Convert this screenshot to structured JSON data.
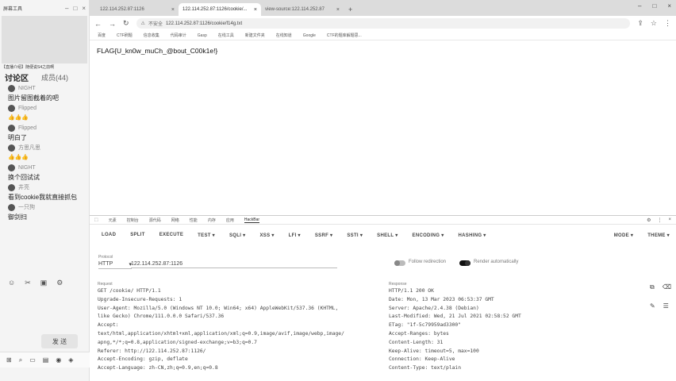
{
  "chat": {
    "window_title": "屏幕工具",
    "notice": "【直播介绍】随便说S4之前啊",
    "tab_discuss": "讨论区",
    "tab_members": "成员(44)",
    "messages": [
      {
        "user": "NIGHT",
        "text": "图片留图截着的吧",
        "emoji": ""
      },
      {
        "user": "Flipped",
        "text": "",
        "emoji": "👍👍👍"
      },
      {
        "user": "Flipped",
        "text": "明白了",
        "emoji": ""
      },
      {
        "user": "方思凡思",
        "text": "",
        "emoji": "👍👍👍"
      },
      {
        "user": "NIGHT",
        "text": "换个回试试",
        "emoji": ""
      },
      {
        "user": "井亮",
        "text": "看到cookie我就直接抓包",
        "emoji": ""
      },
      {
        "user": "一只狗",
        "text": "御剑扫",
        "emoji": ""
      }
    ],
    "send_label": "发 送"
  },
  "browser": {
    "tabs": [
      {
        "title": "122.114.252.87:1126",
        "active": false
      },
      {
        "title": "122.114.252.87:1126/cookie/...",
        "active": true
      },
      {
        "title": "view-source:122.114.252.87",
        "active": false
      }
    ],
    "address": {
      "security": "不安全",
      "url": "122.114.252.87:1126/cookie/f14g.txt"
    },
    "bookmarks": [
      "百度",
      "CTF刷题",
      "信息收集",
      "代码审计",
      "Gasp",
      "在线工具",
      "新建文件夹",
      "在线知道",
      "Google",
      "CTF的题库解题思..."
    ],
    "page_text": "FLAG{U_kn0w_muCh_@bout_C00k1e!}"
  },
  "devtools": {
    "tabs": [
      "元素",
      "控制台",
      "源代码",
      "网络",
      "性能",
      "内存",
      "应用",
      "HackBar"
    ],
    "active_tab": "HackBar",
    "hackbar_menu": [
      "LOAD",
      "SPLIT",
      "EXECUTE",
      "TEST ▾",
      "SQLI ▾",
      "XSS ▾",
      "LFI ▾",
      "SSRF ▾",
      "SSTI ▾",
      "SHELL ▾",
      "ENCODING ▾",
      "HASHING ▾"
    ],
    "hackbar_menu_right": [
      "MODE ▾",
      "THEME ▾"
    ],
    "method_label": "Protocol",
    "method": "HTTP",
    "url_value": "122.114.252.87:1126",
    "follow_redirection": "Follow redirection",
    "render_auto": "Render automatically",
    "request_label": "Request",
    "request_lines": [
      "GET /cookie/ HTTP/1.1",
      "Upgrade-Insecure-Requests: 1",
      "User-Agent: Mozilla/5.0 (Windows NT 10.0; Win64; x64) AppleWebKit/537.36 (KHTML,",
      "like Gecko) Chrome/111.0.0.0 Safari/537.36",
      "Accept:",
      "text/html,application/xhtml+xml,application/xml;q=0.9,image/avif,image/webp,image/",
      "apng,*/*;q=0.8,application/signed-exchange;v=b3;q=0.7",
      "Referer: http://122.114.252.87:1126/",
      "Accept-Encoding: gzip, deflate",
      "Accept-Language: zh-CN,zh;q=0.9,en;q=0.8"
    ],
    "response_label": "Response",
    "response_lines": [
      "HTTP/1.1 200 OK",
      "Date: Mon, 13 Mar 2023 06:53:37 GMT",
      "Server: Apache/2.4.38 (Debian)",
      "Last-Modified: Wed, 21 Jul 2021 02:58:52 GMT",
      "ETag: \"1f-5c79959ad3300\"",
      "Accept-Ranges: bytes",
      "Content-Length: 31",
      "Keep-Alive: timeout=5, max=100",
      "Connection: Keep-Alive",
      "Content-Type: text/plain"
    ]
  }
}
